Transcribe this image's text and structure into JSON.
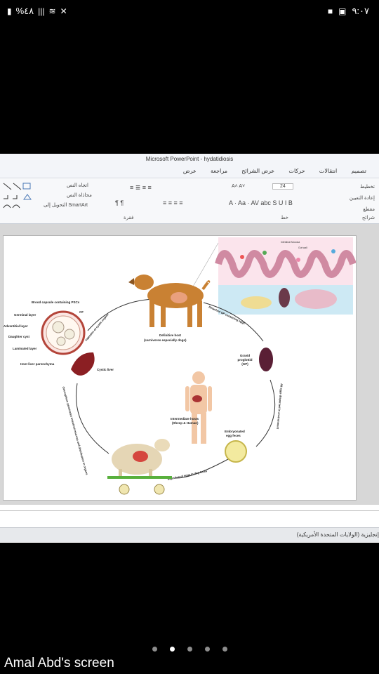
{
  "status_bar": {
    "battery": "%٤٨",
    "time": "٩:٠٧"
  },
  "window": {
    "title": "Microsoft PowerPoint - hydatidiosis",
    "tabs": [
      "تصميم",
      "انتقالات",
      "حركات",
      "عرض الشرائح",
      "مراجعة",
      "عرض"
    ],
    "ribbon": {
      "slides_group": {
        "label": "شرائح",
        "layout": "تخطيط",
        "reset": "إعادة التعيين",
        "section": "مقطع"
      },
      "font_group": {
        "label": "خط",
        "font_size": "24"
      },
      "paragraph_group": {
        "label": "فقرة",
        "text_direction": "اتجاه النص",
        "align_text": "محاذاة النص",
        "smartart": "التحويل إلى SmartArt"
      }
    },
    "language_status": "إنجليزية (الولايات المتحدة الأمريكية)"
  },
  "slide": {
    "labels": {
      "brood_capsule": "Brood capsule containing PSCs",
      "germinal_layer": "Germinal layer",
      "adventitial_layer": "Adventitial layer",
      "daughter_cyst": "Daughter cyst",
      "laminated_layer": "Laminated layer",
      "host_liver": "Host liver parenchyma",
      "cf": "CF",
      "cystic_liver": "Cystic liver",
      "definitive_host": "Definitive host",
      "definitive_host_sub": "(carnivores especially dogs)",
      "ingestion_cystic": "Ingestion of cystic organs",
      "detached_gp": "Detached GP containing eggs",
      "gravid_proglottid_1": "Gravid",
      "gravid_proglottid_2": "proglottid",
      "gravid_proglottid_3": "(GP)",
      "all_eggs": "All eggs dispersed in environment",
      "intermediate_hosts": "Intermediate hosts",
      "intermediate_hosts_sub": "(Sheep & Human)",
      "embryonated_1": "Embryonated",
      "embryonated_2": "egg feces",
      "ingestion_eggs": "Ingestion of eggs in dog feces",
      "oncosphere": "Oncosphere penetrates intestinal mucosa and distribution in organs",
      "intestinal_mucosa": "Intestinal Mucosa",
      "gut_wall": "Gut wall"
    }
  },
  "screen_share": {
    "caption": "Amal Abd's screen",
    "pages": 5,
    "active_page": 2
  }
}
